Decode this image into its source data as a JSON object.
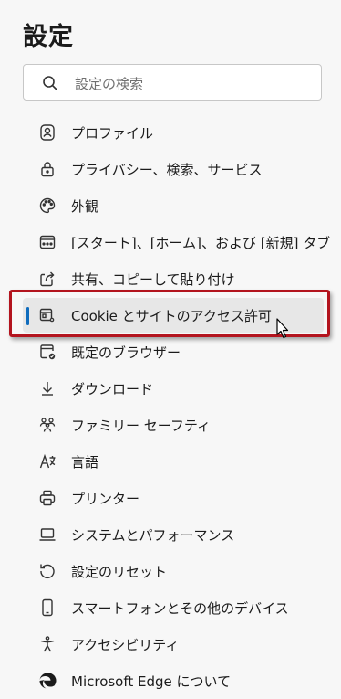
{
  "header": {
    "title": "設定"
  },
  "search": {
    "placeholder": "設定の検索"
  },
  "menu": {
    "items": [
      {
        "label": "プロファイル",
        "icon": "profile-icon"
      },
      {
        "label": "プライバシー、検索、サービス",
        "icon": "lock-icon"
      },
      {
        "label": "外観",
        "icon": "palette-icon"
      },
      {
        "label": "[スタート]、[ホーム]、および [新規] タブ",
        "icon": "start-page-icon"
      },
      {
        "label": "共有、コピーして貼り付け",
        "icon": "share-icon"
      },
      {
        "label": "Cookie とサイトのアクセス許可",
        "icon": "site-permissions-icon",
        "selected": true
      },
      {
        "label": "既定のブラウザー",
        "icon": "default-browser-icon"
      },
      {
        "label": "ダウンロード",
        "icon": "download-icon"
      },
      {
        "label": "ファミリー セーフティ",
        "icon": "family-icon"
      },
      {
        "label": "言語",
        "icon": "language-icon"
      },
      {
        "label": "プリンター",
        "icon": "printer-icon"
      },
      {
        "label": "システムとパフォーマンス",
        "icon": "laptop-icon"
      },
      {
        "label": "設定のリセット",
        "icon": "reset-icon"
      },
      {
        "label": "スマートフォンとその他のデバイス",
        "icon": "phone-icon"
      },
      {
        "label": "アクセシビリティ",
        "icon": "accessibility-icon"
      },
      {
        "label": "Microsoft Edge について",
        "icon": "edge-logo-icon"
      }
    ]
  },
  "colors": {
    "background": "#f7f7f7",
    "accent": "#0f6cbd",
    "selected_background": "#e7e7e7",
    "annotation_border": "#b3141e"
  }
}
